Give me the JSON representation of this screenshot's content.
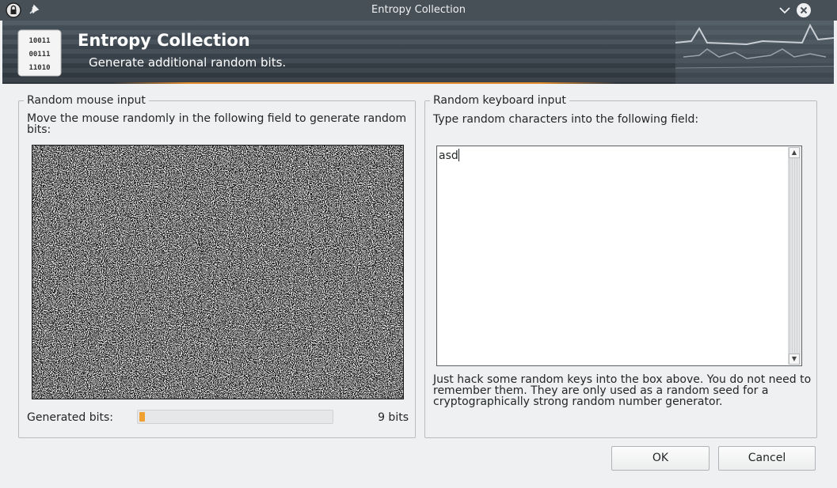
{
  "window": {
    "title": "Entropy Collection",
    "icons": [
      "app-lock-icon",
      "pin-icon",
      "minimize-chevron-icon",
      "close-icon"
    ]
  },
  "header": {
    "title": "Entropy Collection",
    "subtitle": "Generate additional random bits.",
    "logo_rows": [
      "10011",
      "00111",
      "11010"
    ]
  },
  "mouse_group": {
    "title": "Random mouse input",
    "description": "Move the mouse randomly in the following field to generate random bits:",
    "generated_label": "Generated bits:",
    "generated_value": "9 bits",
    "progress_fraction": 0.03
  },
  "keyboard_group": {
    "title": "Random keyboard input",
    "description": "Type random characters into the following field:",
    "input_value": "asd",
    "note": "Just hack some random keys into the box above. You do not need to remember them. They are only used as a random seed for a cryptographically strong random number generator."
  },
  "buttons": {
    "ok": "OK",
    "cancel": "Cancel"
  },
  "colors": {
    "titlebar": "#475057",
    "progress_fill": "#f0a030",
    "accent_orange": "#e08a2a"
  }
}
